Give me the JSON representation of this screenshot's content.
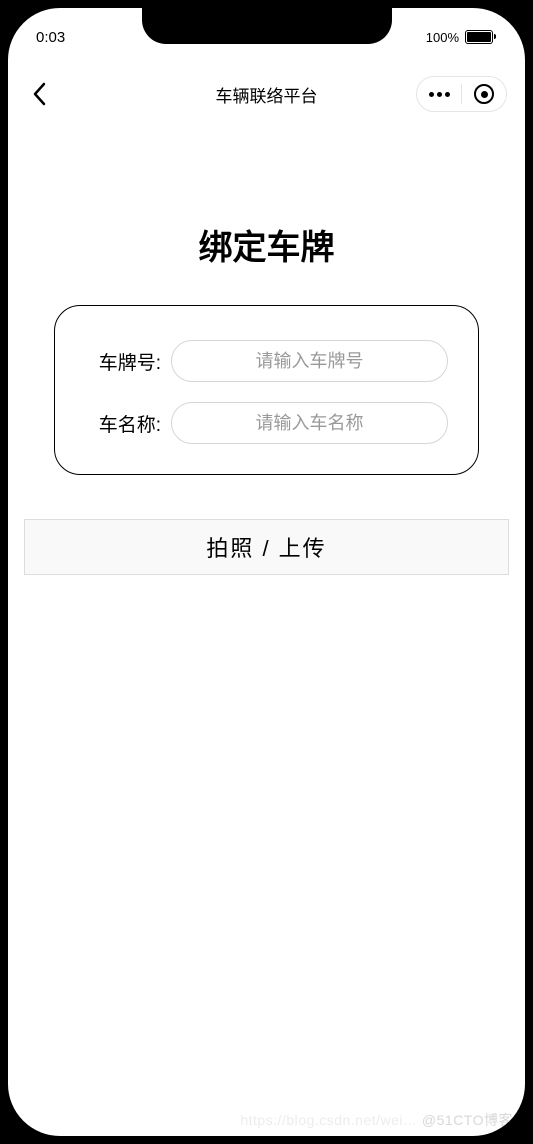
{
  "status": {
    "time": "0:03",
    "battery_text": "100%"
  },
  "nav": {
    "title": "车辆联络平台"
  },
  "page": {
    "heading": "绑定车牌"
  },
  "form": {
    "plate_label": "车牌号:",
    "plate_placeholder": "请输入车牌号",
    "plate_value": "",
    "name_label": "车名称:",
    "name_placeholder": "请输入车名称",
    "name_value": ""
  },
  "actions": {
    "upload_label": "拍照 / 上传"
  },
  "watermark": {
    "faint": "https://blog.csdn.net/wei… ",
    "text": "@51CTO博客"
  }
}
